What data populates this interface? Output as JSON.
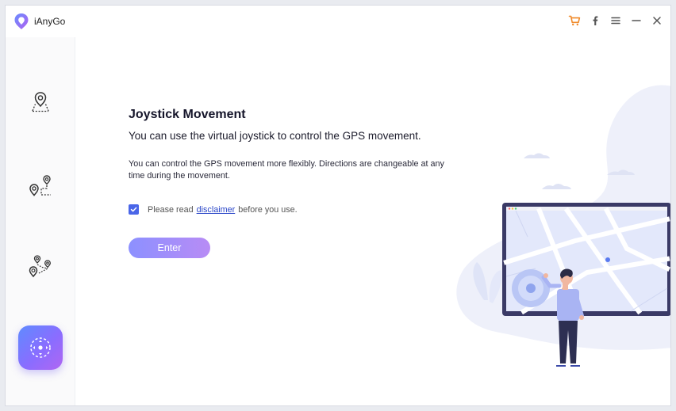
{
  "app": {
    "title": "iAnyGo"
  },
  "titlebar": {
    "controls": [
      "cart-icon",
      "facebook-icon",
      "menu-icon",
      "minimize-icon",
      "close-icon"
    ],
    "cart_color": "#f08a2a"
  },
  "sidebar": {
    "items": [
      {
        "icon": "teleport-location-icon",
        "active": false
      },
      {
        "icon": "two-spot-route-icon",
        "active": false
      },
      {
        "icon": "multi-spot-route-icon",
        "active": false
      },
      {
        "icon": "joystick-icon",
        "active": true
      }
    ]
  },
  "main": {
    "heading": "Joystick Movement",
    "subheading": "You can use the virtual joystick to control the GPS movement.",
    "description": "You can control the GPS movement more flexibly. Directions are changeable at any time during the movement.",
    "checkbox": {
      "checked": true,
      "prefix": "Please read",
      "link": "disclaimer",
      "suffix": "before you use."
    },
    "enter_label": "Enter"
  },
  "colors": {
    "accent": "#4a66e8",
    "button_gradient_start": "#8c90ff",
    "button_gradient_end": "#b88cf5",
    "link": "#2a46c8"
  }
}
